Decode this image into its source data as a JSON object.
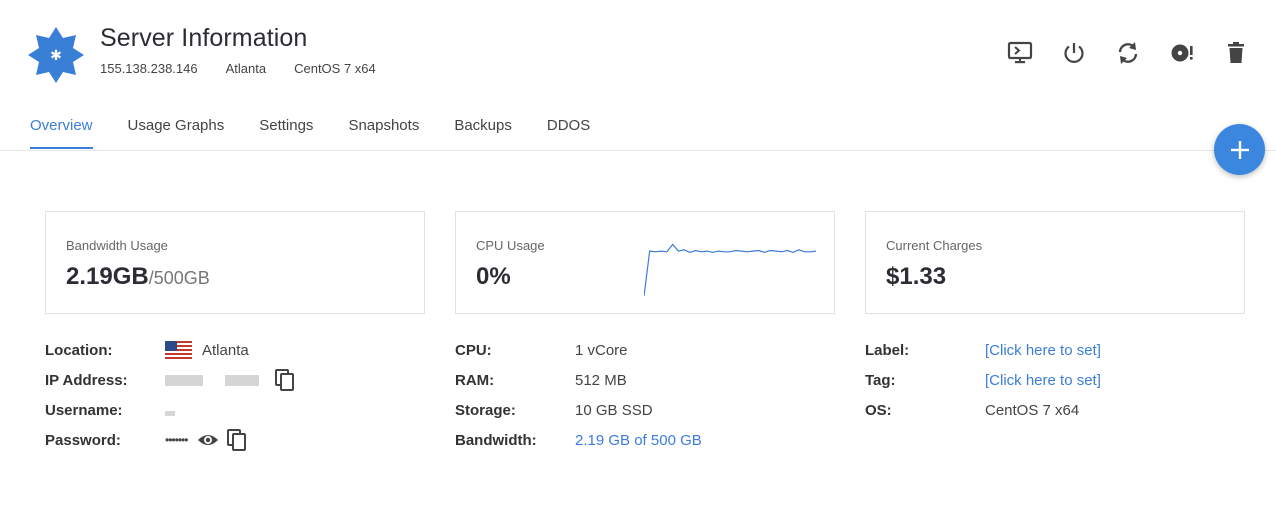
{
  "header": {
    "title": "Server Information",
    "ip": "155.138.238.146",
    "location": "Atlanta",
    "os": "CentOS 7 x64",
    "logo_icon": "vultr-star-logo"
  },
  "toolbar": [
    {
      "name": "console",
      "icon": "console-icon"
    },
    {
      "name": "power",
      "icon": "power-icon"
    },
    {
      "name": "restart",
      "icon": "restart-icon"
    },
    {
      "name": "reinstall",
      "icon": "disc-alert-icon"
    },
    {
      "name": "destroy",
      "icon": "trash-icon"
    }
  ],
  "tabs": [
    "Overview",
    "Usage Graphs",
    "Settings",
    "Snapshots",
    "Backups",
    "DDOS"
  ],
  "active_tab": "Overview",
  "cards": {
    "bandwidth": {
      "label": "Bandwidth Usage",
      "value": "2.19GB",
      "limit": "/500GB"
    },
    "cpu": {
      "label": "CPU Usage",
      "value": "0%"
    },
    "charges": {
      "label": "Current Charges",
      "value": "$1.33"
    }
  },
  "cpu_sparkline": [
    0,
    68,
    67,
    68,
    67,
    78,
    68,
    70,
    66,
    69,
    67,
    68,
    66,
    68,
    67,
    67,
    69,
    68,
    67,
    68,
    69,
    66,
    69,
    68,
    67,
    69,
    66,
    70,
    67,
    67,
    68
  ],
  "server_details": {
    "location_label": "Location:",
    "location_value": "Atlanta",
    "ip_label": "IP Address:",
    "username_label": "Username:",
    "password_label": "Password:",
    "password_value": "•••••••"
  },
  "specs": {
    "cpu_label": "CPU:",
    "cpu_value": "1 vCore",
    "ram_label": "RAM:",
    "ram_value": "512 MB",
    "storage_label": "Storage:",
    "storage_value": "10 GB SSD",
    "bandwidth_label": "Bandwidth:",
    "bandwidth_value": "2.19 GB of 500 GB"
  },
  "meta": {
    "label_label": "Label:",
    "label_value": "[Click here to set]",
    "tag_label": "Tag:",
    "tag_value": "[Click here to set]",
    "os_label": "OS:",
    "os_value": "CentOS 7 x64"
  },
  "colors": {
    "accent": "#3b7dd8",
    "fab": "#3b87e0",
    "logo": "#3a7fd6"
  }
}
